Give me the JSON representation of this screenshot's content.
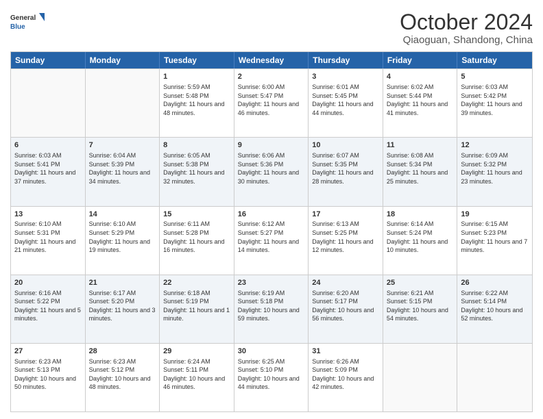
{
  "header": {
    "logo_general": "General",
    "logo_blue": "Blue",
    "month_title": "October 2024",
    "subtitle": "Qiaoguan, Shandong, China"
  },
  "calendar": {
    "days_of_week": [
      "Sunday",
      "Monday",
      "Tuesday",
      "Wednesday",
      "Thursday",
      "Friday",
      "Saturday"
    ],
    "rows": [
      [
        {
          "day": "",
          "text": ""
        },
        {
          "day": "",
          "text": ""
        },
        {
          "day": "1",
          "text": "Sunrise: 5:59 AM\nSunset: 5:48 PM\nDaylight: 11 hours and 48 minutes."
        },
        {
          "day": "2",
          "text": "Sunrise: 6:00 AM\nSunset: 5:47 PM\nDaylight: 11 hours and 46 minutes."
        },
        {
          "day": "3",
          "text": "Sunrise: 6:01 AM\nSunset: 5:45 PM\nDaylight: 11 hours and 44 minutes."
        },
        {
          "day": "4",
          "text": "Sunrise: 6:02 AM\nSunset: 5:44 PM\nDaylight: 11 hours and 41 minutes."
        },
        {
          "day": "5",
          "text": "Sunrise: 6:03 AM\nSunset: 5:42 PM\nDaylight: 11 hours and 39 minutes."
        }
      ],
      [
        {
          "day": "6",
          "text": "Sunrise: 6:03 AM\nSunset: 5:41 PM\nDaylight: 11 hours and 37 minutes."
        },
        {
          "day": "7",
          "text": "Sunrise: 6:04 AM\nSunset: 5:39 PM\nDaylight: 11 hours and 34 minutes."
        },
        {
          "day": "8",
          "text": "Sunrise: 6:05 AM\nSunset: 5:38 PM\nDaylight: 11 hours and 32 minutes."
        },
        {
          "day": "9",
          "text": "Sunrise: 6:06 AM\nSunset: 5:36 PM\nDaylight: 11 hours and 30 minutes."
        },
        {
          "day": "10",
          "text": "Sunrise: 6:07 AM\nSunset: 5:35 PM\nDaylight: 11 hours and 28 minutes."
        },
        {
          "day": "11",
          "text": "Sunrise: 6:08 AM\nSunset: 5:34 PM\nDaylight: 11 hours and 25 minutes."
        },
        {
          "day": "12",
          "text": "Sunrise: 6:09 AM\nSunset: 5:32 PM\nDaylight: 11 hours and 23 minutes."
        }
      ],
      [
        {
          "day": "13",
          "text": "Sunrise: 6:10 AM\nSunset: 5:31 PM\nDaylight: 11 hours and 21 minutes."
        },
        {
          "day": "14",
          "text": "Sunrise: 6:10 AM\nSunset: 5:29 PM\nDaylight: 11 hours and 19 minutes."
        },
        {
          "day": "15",
          "text": "Sunrise: 6:11 AM\nSunset: 5:28 PM\nDaylight: 11 hours and 16 minutes."
        },
        {
          "day": "16",
          "text": "Sunrise: 6:12 AM\nSunset: 5:27 PM\nDaylight: 11 hours and 14 minutes."
        },
        {
          "day": "17",
          "text": "Sunrise: 6:13 AM\nSunset: 5:25 PM\nDaylight: 11 hours and 12 minutes."
        },
        {
          "day": "18",
          "text": "Sunrise: 6:14 AM\nSunset: 5:24 PM\nDaylight: 11 hours and 10 minutes."
        },
        {
          "day": "19",
          "text": "Sunrise: 6:15 AM\nSunset: 5:23 PM\nDaylight: 11 hours and 7 minutes."
        }
      ],
      [
        {
          "day": "20",
          "text": "Sunrise: 6:16 AM\nSunset: 5:22 PM\nDaylight: 11 hours and 5 minutes."
        },
        {
          "day": "21",
          "text": "Sunrise: 6:17 AM\nSunset: 5:20 PM\nDaylight: 11 hours and 3 minutes."
        },
        {
          "day": "22",
          "text": "Sunrise: 6:18 AM\nSunset: 5:19 PM\nDaylight: 11 hours and 1 minute."
        },
        {
          "day": "23",
          "text": "Sunrise: 6:19 AM\nSunset: 5:18 PM\nDaylight: 10 hours and 59 minutes."
        },
        {
          "day": "24",
          "text": "Sunrise: 6:20 AM\nSunset: 5:17 PM\nDaylight: 10 hours and 56 minutes."
        },
        {
          "day": "25",
          "text": "Sunrise: 6:21 AM\nSunset: 5:15 PM\nDaylight: 10 hours and 54 minutes."
        },
        {
          "day": "26",
          "text": "Sunrise: 6:22 AM\nSunset: 5:14 PM\nDaylight: 10 hours and 52 minutes."
        }
      ],
      [
        {
          "day": "27",
          "text": "Sunrise: 6:23 AM\nSunset: 5:13 PM\nDaylight: 10 hours and 50 minutes."
        },
        {
          "day": "28",
          "text": "Sunrise: 6:23 AM\nSunset: 5:12 PM\nDaylight: 10 hours and 48 minutes."
        },
        {
          "day": "29",
          "text": "Sunrise: 6:24 AM\nSunset: 5:11 PM\nDaylight: 10 hours and 46 minutes."
        },
        {
          "day": "30",
          "text": "Sunrise: 6:25 AM\nSunset: 5:10 PM\nDaylight: 10 hours and 44 minutes."
        },
        {
          "day": "31",
          "text": "Sunrise: 6:26 AM\nSunset: 5:09 PM\nDaylight: 10 hours and 42 minutes."
        },
        {
          "day": "",
          "text": ""
        },
        {
          "day": "",
          "text": ""
        }
      ]
    ]
  }
}
